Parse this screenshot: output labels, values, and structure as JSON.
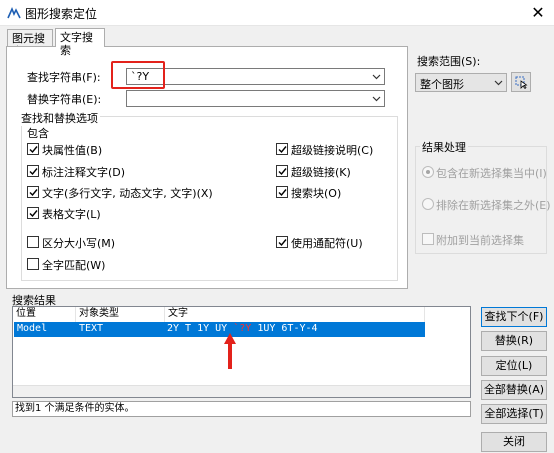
{
  "window": {
    "title": "图形搜索定位",
    "close_glyph": "✕"
  },
  "tabs": [
    {
      "label": "图元搜索"
    },
    {
      "label": "文字搜索"
    }
  ],
  "find": {
    "label": "查找字符串(F):",
    "value": "`?Y"
  },
  "replace": {
    "label": "替换字符串(E):",
    "value": ""
  },
  "options_group": {
    "title": "查找和替换选项",
    "include_label": "包含",
    "checkboxes": [
      {
        "label": "块属性值(B)",
        "checked": true
      },
      {
        "label": "标注注释文字(D)",
        "checked": true
      },
      {
        "label": "文字(多行文字, 动态文字, 文字)(X)",
        "checked": true
      },
      {
        "label": "表格文字(L)",
        "checked": true
      },
      {
        "label": "超级链接说明(C)",
        "checked": true
      },
      {
        "label": "超级链接(K)",
        "checked": true
      },
      {
        "label": "搜索块(O)",
        "checked": true
      },
      {
        "label": "区分大小写(M)",
        "checked": false
      },
      {
        "label": "全字匹配(W)",
        "checked": false
      },
      {
        "label": "使用通配符(U)",
        "checked": true
      }
    ]
  },
  "search_scope": {
    "label": "搜索范围(S):",
    "value": "整个图形"
  },
  "result_handling": {
    "title": "结果处理",
    "radio1": "包含在新选择集当中(I)",
    "radio2": "排除在新选择集之外(E)",
    "checkbox": "附加到当前选择集"
  },
  "results": {
    "label": "搜索结果",
    "columns": [
      "位置",
      "对象类型",
      "文字"
    ],
    "rows": [
      {
        "location": "Model",
        "type": "TEXT",
        "text_before": "2Y T 1Y UY ",
        "text_match": "`?Y",
        "text_after": " 1UY 6T-Y-4"
      }
    ]
  },
  "status_text": "找到1 个满足条件的实体。",
  "buttons": {
    "find_next": "查找下个(F)",
    "replace": "替换(R)",
    "locate": "定位(L)",
    "replace_all": "全部替换(A)",
    "select_all": "全部选择(T)",
    "close": "关闭"
  },
  "colors": {
    "selection": "#0078d7",
    "annotation_red": "#e3221b",
    "match_highlight": "#ff2d2d"
  }
}
